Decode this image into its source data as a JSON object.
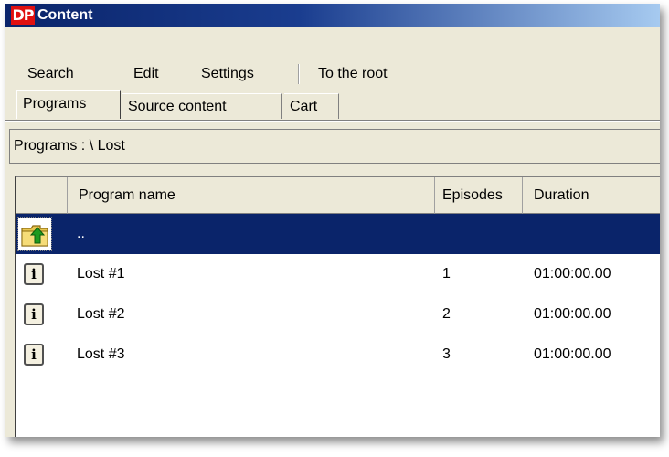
{
  "window": {
    "logo_text": "DP",
    "title": "Content"
  },
  "menu": {
    "items": [
      "Search",
      "Edit",
      "Settings",
      "To the root"
    ]
  },
  "tabs": [
    {
      "label": "Programs",
      "active": true
    },
    {
      "label": "Source content",
      "active": false
    },
    {
      "label": "Cart",
      "active": false
    }
  ],
  "path_bar": {
    "label": "Programs :  \\ Lost"
  },
  "grid": {
    "columns": [
      "Program name",
      "Episodes",
      "Duration"
    ],
    "up_row": {
      "name": "..",
      "icon": "folder-up-icon",
      "selected": true
    },
    "rows": [
      {
        "icon": "info-icon",
        "name": "Lost #1",
        "episodes": "1",
        "duration": "01:00:00.00"
      },
      {
        "icon": "info-icon",
        "name": "Lost #2",
        "episodes": "2",
        "duration": "01:00:00.00"
      },
      {
        "icon": "info-icon",
        "name": "Lost #3",
        "episodes": "3",
        "duration": "01:00:00.00"
      }
    ],
    "colors": {
      "selected_row": "#0a246a",
      "title_bar": "#0a246a",
      "logo": "#e01010"
    }
  }
}
